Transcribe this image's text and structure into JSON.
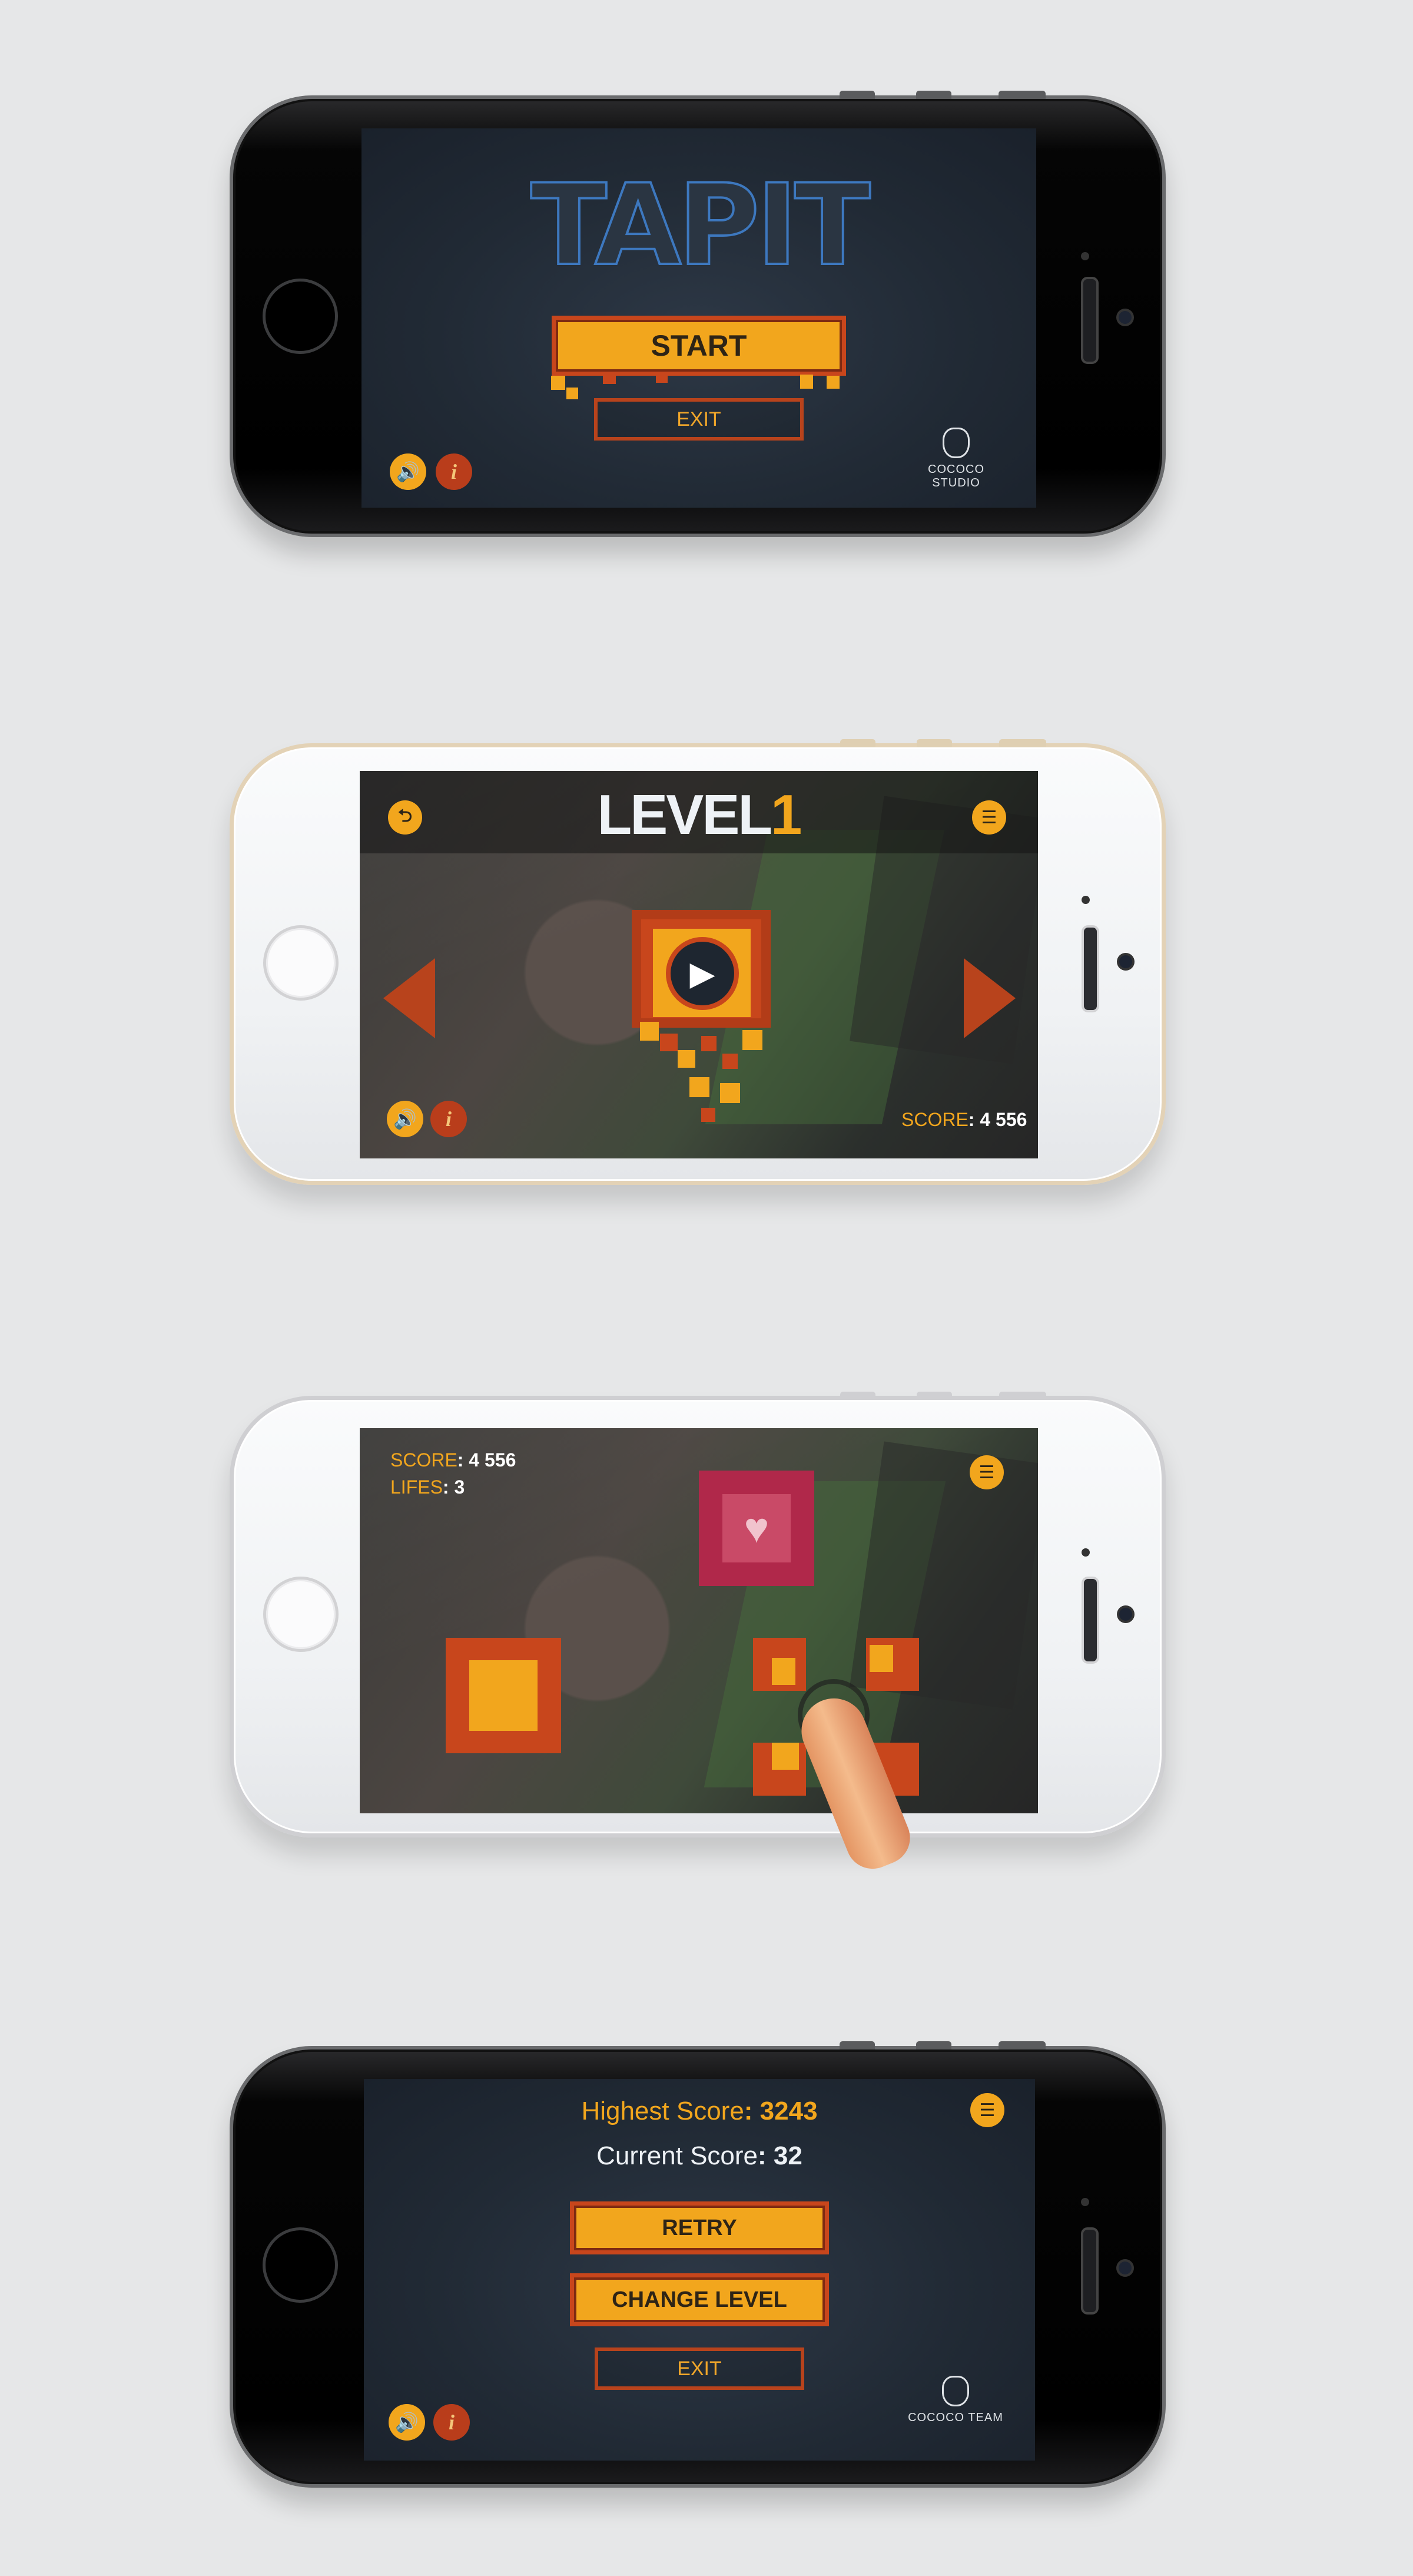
{
  "screens": {
    "menu": {
      "logo": "TAPIT",
      "start_label": "START",
      "exit_label": "EXIT",
      "studio_name": "COCOCO STUDIO",
      "info_glyph": "i",
      "sound_glyph": "🔊"
    },
    "level_select": {
      "title_word": "LEVEL",
      "title_number": "1",
      "score_label": "SCORE",
      "score_value": ": 4 556",
      "info_glyph": "i",
      "sound_glyph": "🔊",
      "back_glyph": "⮌",
      "menu_glyph": "☰",
      "play_glyph": "▶"
    },
    "gameplay": {
      "score_label": "SCORE",
      "score_value": ": 4 556",
      "lifes_label": "LIFES",
      "lifes_value": ": 3",
      "menu_glyph": "☰",
      "heart_glyph": "♥"
    },
    "game_over": {
      "highest_label": "Highest Score",
      "highest_value": ": 3243",
      "current_label": "Current Score",
      "current_value": ": 32",
      "retry_label": "RETRY",
      "change_level_label": "CHANGE LEVEL",
      "exit_label": "EXIT",
      "team_name": "COCOCO TEAM",
      "info_glyph": "i",
      "sound_glyph": "🔊",
      "menu_glyph": "☰"
    }
  },
  "colors": {
    "accent_orange": "#f2a61d",
    "accent_red": "#c8461c",
    "logo_blue": "#3d78bf",
    "heart_pink": "#b0284a",
    "navy_bg": "#212a35"
  },
  "icons": [
    "home-button",
    "sound-icon",
    "info-icon",
    "back-icon",
    "menu-icon",
    "play-icon",
    "heart-icon",
    "studio-logo-icon",
    "finger-icon"
  ]
}
